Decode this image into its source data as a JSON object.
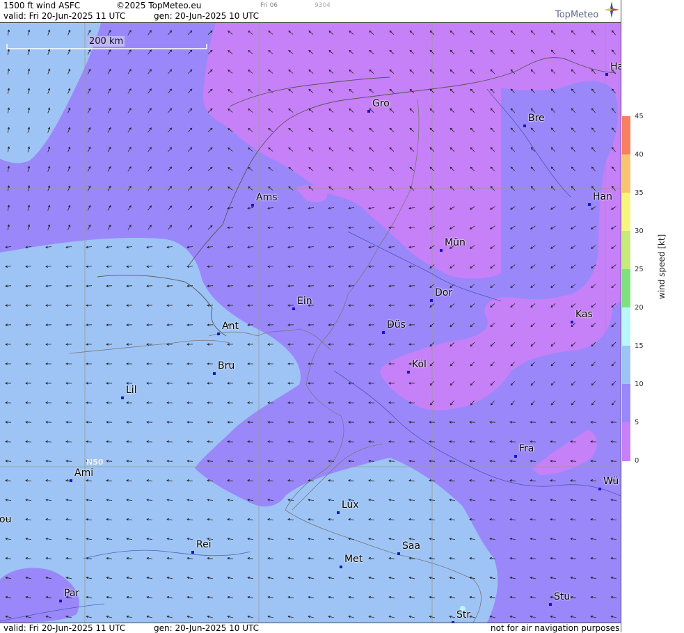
{
  "header": {
    "product": "1500 ft wind ASFC",
    "copyright": "©2025 TopMeteo.eu",
    "small_day": "Fri 06",
    "small_code": "9304",
    "valid": "valid:  Fri  20-Jun-2025  11 UTC",
    "gen": "gen: 20-Jun-2025 10 UTC",
    "brand": "TopMeteo"
  },
  "footer": {
    "valid": "valid:  Fri  20-Jun-2025  11 UTC",
    "gen": "gen: 20-Jun-2025 10 UTC",
    "disclaimer": "not for air navigation purposes"
  },
  "map": {
    "scale_label": "200 km",
    "lat_label": "N50",
    "cities": [
      {
        "name": "Ha"
      },
      {
        "name": "Gro"
      },
      {
        "name": "Bre"
      },
      {
        "name": "Ams"
      },
      {
        "name": "Han"
      },
      {
        "name": "Mün"
      },
      {
        "name": "Dor"
      },
      {
        "name": "Ein"
      },
      {
        "name": "Kas"
      },
      {
        "name": "Ant"
      },
      {
        "name": "Düs"
      },
      {
        "name": "Köl"
      },
      {
        "name": "Bru"
      },
      {
        "name": "Lil"
      },
      {
        "name": "Fra"
      },
      {
        "name": "Ami"
      },
      {
        "name": "Wü"
      },
      {
        "name": "Lux"
      },
      {
        "name": "ou"
      },
      {
        "name": "Rei"
      },
      {
        "name": "Saa"
      },
      {
        "name": "Met"
      },
      {
        "name": "Par"
      },
      {
        "name": "Stu"
      },
      {
        "name": "Str"
      }
    ]
  },
  "legend": {
    "title": "wind  speed  [kt]",
    "ticks": [
      "45",
      "40",
      "35",
      "30",
      "25",
      "20",
      "15",
      "10",
      "5",
      "0"
    ],
    "colors": {
      "0-5": "#c680f8",
      "5-10": "#9a88fa",
      "10-15": "#9ec4f6",
      "15-20": "#baf6fa",
      "20-25": "#7fe07f",
      "25-30": "#c6ea7c",
      "30-35": "#f6f67e",
      "35-40": "#f8c474",
      "40-45": "#f68060"
    }
  }
}
